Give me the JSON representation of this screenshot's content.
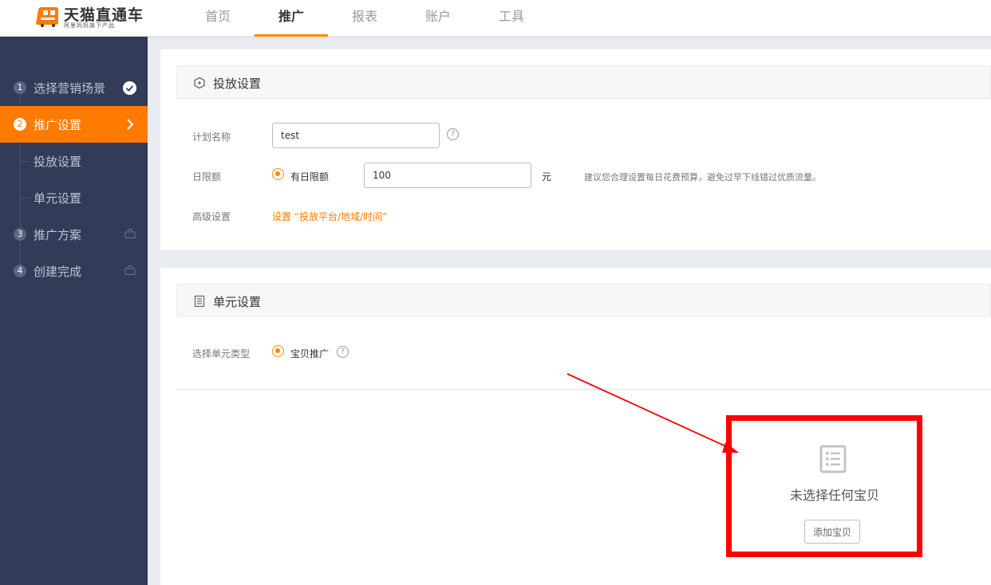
{
  "brand": {
    "title": "天猫直通车",
    "subtitle": "阿里妈妈旗下产品",
    "color": "#ff7a00"
  },
  "top_nav": {
    "items": [
      {
        "label": "首页",
        "active": false
      },
      {
        "label": "推广",
        "active": true
      },
      {
        "label": "报表",
        "active": false
      },
      {
        "label": "账户",
        "active": false
      },
      {
        "label": "工具",
        "active": false
      }
    ]
  },
  "sidebar": {
    "steps": [
      {
        "num": "1",
        "label": "选择营销场景",
        "status": "done",
        "icon": "check-icon"
      },
      {
        "num": "2",
        "label": "推广设置",
        "status": "active",
        "icon": "chevron-right-icon"
      },
      {
        "num": "3",
        "label": "推广方案",
        "status": "locked",
        "icon": "lock-icon"
      },
      {
        "num": "4",
        "label": "创建完成",
        "status": "locked",
        "icon": "lock-icon"
      }
    ],
    "substeps": [
      "投放设置",
      "单元设置"
    ],
    "bg_color": "#323b57",
    "active_color": "#ff7a00"
  },
  "delivery_settings": {
    "title": "投放设置",
    "icon": "hexagon-icon",
    "plan_name_label": "计划名称",
    "plan_name_value": "test",
    "daily_limit_label": "日限额",
    "daily_limit_option": "有日限额",
    "daily_limit_value": "100",
    "daily_limit_unit": "元",
    "daily_limit_hint": "建议您合理设置每日花费预算，避免过早下线错过优质流量。",
    "advanced_label": "高级设置",
    "advanced_link": "设置 “投放平台/地域/时间”"
  },
  "unit_settings": {
    "title": "单元设置",
    "icon": "list-icon",
    "type_label": "选择单元类型",
    "type_option": "宝贝推广",
    "empty_text": "未选择任何宝贝",
    "add_button": "添加宝贝"
  },
  "annotation": {
    "color": "#ff0000"
  }
}
